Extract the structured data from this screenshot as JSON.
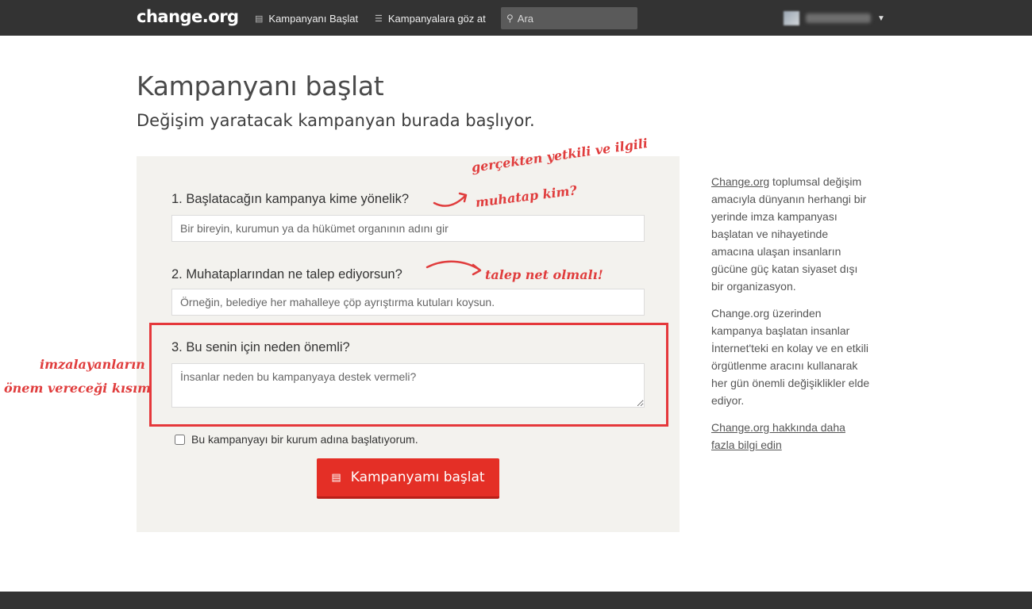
{
  "nav": {
    "logo": "change.org",
    "start_campaign": "Kampanyanı Başlat",
    "browse_campaigns": "Kampanyalara göz at",
    "search_placeholder": "Ara"
  },
  "header": {
    "title": "Kampanyanı başlat",
    "subtitle": "Değişim yaratacak kampanyan burada başlıyor."
  },
  "form": {
    "q1": {
      "label": "1. Başlatacağın kampanya kime yönelik?",
      "placeholder": "Bir bireyin, kurumun ya da hükümet organının adını gir"
    },
    "q2": {
      "label": "2. Muhataplarından ne talep ediyorsun?",
      "placeholder": "Örneğin, belediye her mahalleye çöp ayrıştırma kutuları koysun."
    },
    "q3": {
      "label": "3. Bu senin için neden önemli?",
      "placeholder": "İnsanlar neden bu kampanyaya destek vermeli?"
    },
    "org_checkbox_label": "Bu kampanyayı bir kurum adına başlatıyorum.",
    "org_checkbox_checked": false,
    "submit_label": "Kampanyamı başlat"
  },
  "annotations": {
    "target_note_line1": "gerçekten yetkili ve ilgili",
    "target_note_line2": "muhatap kim?",
    "demand_note": "talep net olmalı!",
    "importance_note_line1": "imzalayanların",
    "importance_note_line2": "önem vereceği kısım",
    "color": "#e03d3d"
  },
  "sidebar": {
    "p1_link": "Change.org",
    "p1_rest": " toplumsal değişim amacıyla dünyanın herhangi bir yerinde imza kampanyası başlatan ve nihayetinde amacına ulaşan insanların gücüne güç katan siyaset dışı bir organizasyon.",
    "p2": "Change.org üzerinden kampanya başlatan insanlar İnternet'teki en kolay ve en etkili örgütlenme aracını kullanarak her gün önemli değişiklikler elde ediyor.",
    "learn_more_link": "Change.org hakkında daha fazla bilgi edin"
  },
  "colors": {
    "topbar": "#333333",
    "panel": "#f3f2ee",
    "cta": "#e42f26",
    "highlight_border": "#e5383b"
  }
}
